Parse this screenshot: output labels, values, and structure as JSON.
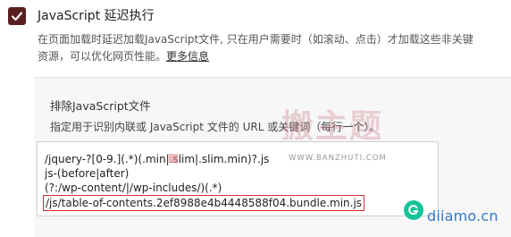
{
  "setting": {
    "checked": true,
    "title": "JavaScript 延迟执行",
    "desc_line1": "在页面加载时延迟加载JavaScript文件, 只在用户需要时（如滚动、点击）才加载这些非关键",
    "desc_line2_prefix": "资源，可以优化网页性能。",
    "more_link": "更多信息"
  },
  "exclude": {
    "title": "排除JavaScript文件",
    "desc": "指定用于识别内联或 JavaScript 文件的 URL 或关键词（每行一个）。",
    "lines": [
      "/jquery-?[0-9.](.*)(.min|.slim|.slim.min)?.js",
      "js-(before|after)",
      "(?:/wp-content/|/wp-includes/)(.*)",
      "/js/table-of-contents.2ef8988e4b4448588f04.bundle.min.js"
    ],
    "highlighted_line_index": 3
  },
  "watermark": {
    "chars": "搬主题",
    "url": "WWW.BANZHUTI.COM"
  },
  "site_watermark": "diiamo.cn",
  "colors": {
    "checkbox": "#5a1f1f",
    "highlight_border": "#d32f2f",
    "grammar_icon": "#15c39a",
    "site_watermark": "#2f77c8"
  },
  "icons": {
    "checkbox": "checkmark-icon",
    "grammar": "grammarly-icon"
  }
}
